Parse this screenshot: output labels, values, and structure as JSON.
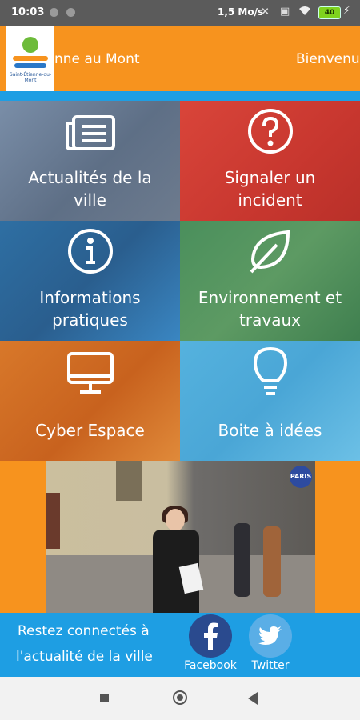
{
  "status_bar": {
    "time": "10:03",
    "network_speed": "1,5 Mo/s",
    "battery_level": "40"
  },
  "header": {
    "logo_text": "Saint-Étienne-du-Mont",
    "scroll_text_left": "nne au Mont",
    "scroll_text_right": "Bienvenu"
  },
  "tiles": [
    {
      "label_line1": "Actualités de la",
      "label_line2": "ville",
      "icon": "newspaper-icon"
    },
    {
      "label_line1": "Signaler un",
      "label_line2": "incident",
      "icon": "question-icon"
    },
    {
      "label_line1": "Informations",
      "label_line2": "pratiques",
      "icon": "info-icon"
    },
    {
      "label_line1": "Environnement et",
      "label_line2": "travaux",
      "icon": "leaf-icon"
    },
    {
      "label_line1": "Cyber Espace",
      "label_line2": "",
      "icon": "monitor-icon"
    },
    {
      "label_line1": "Boite à idées",
      "label_line2": "",
      "icon": "lightbulb-icon"
    }
  ],
  "video": {
    "badge_text": "PARIS"
  },
  "footer": {
    "line1": "Restez connectés à",
    "line2": "l'actualité de la ville",
    "facebook_label": "Facebook",
    "twitter_label": "Twitter"
  },
  "colors": {
    "orange": "#f7931e",
    "blue": "#1e9ee3"
  }
}
